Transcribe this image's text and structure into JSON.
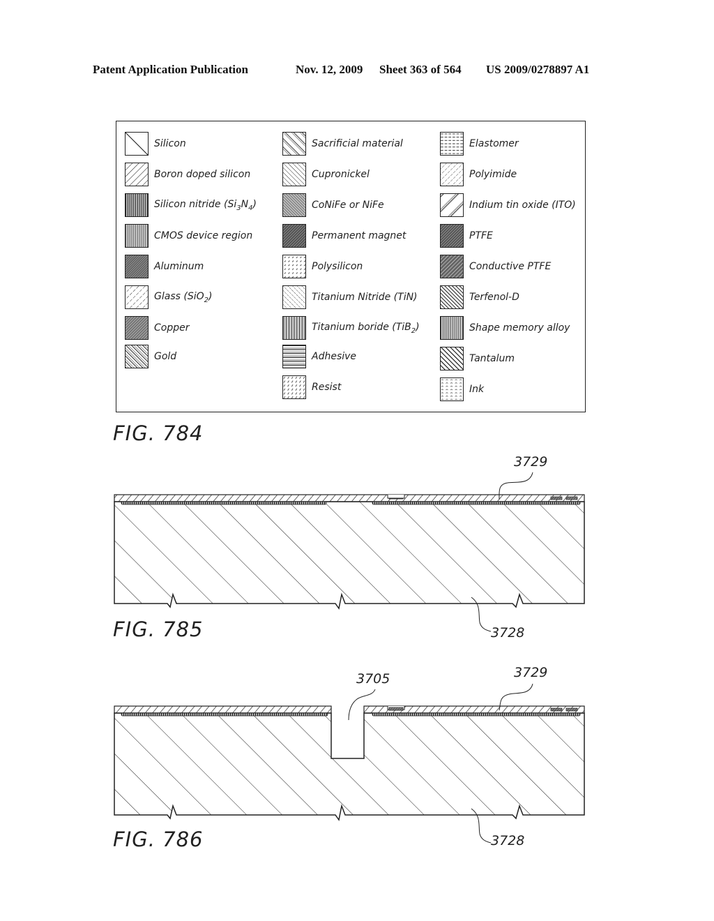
{
  "header": {
    "publication": "Patent Application Publication",
    "date": "Nov. 12, 2009",
    "sheet": "Sheet 363 of 564",
    "number": "US 2009/0278897 A1"
  },
  "legend": {
    "columns": [
      [
        {
          "label": "Silicon",
          "pattern": "silicon"
        },
        {
          "label": "Boron doped silicon",
          "pattern": "boron"
        },
        {
          "label": "Silicon nitride (Si3N4)",
          "pattern": "nitride"
        },
        {
          "label": "CMOS device region",
          "pattern": "cmos"
        },
        {
          "label": "Aluminum",
          "pattern": "aluminum"
        },
        {
          "label": "Glass (SiO2)",
          "pattern": "glass"
        },
        {
          "label": "Copper",
          "pattern": "copper"
        },
        {
          "label": "Gold",
          "pattern": "gold"
        }
      ],
      [
        {
          "label": "Sacrificial material",
          "pattern": "sacrificial"
        },
        {
          "label": "Cupronickel",
          "pattern": "cupronickel"
        },
        {
          "label": "CoNiFe or NiFe",
          "pattern": "conife"
        },
        {
          "label": "Permanent magnet",
          "pattern": "magnet"
        },
        {
          "label": "Polysilicon",
          "pattern": "polysilicon"
        },
        {
          "label": "Titanium Nitride (TiN)",
          "pattern": "tin"
        },
        {
          "label": "Titanium boride (TiB2)",
          "pattern": "tib2"
        },
        {
          "label": "Adhesive",
          "pattern": "adhesive"
        },
        {
          "label": "Resist",
          "pattern": "resist"
        }
      ],
      [
        {
          "label": "Elastomer",
          "pattern": "elastomer"
        },
        {
          "label": "Polyimide",
          "pattern": "polyimide"
        },
        {
          "label": "Indium tin oxide (ITO)",
          "pattern": "ito"
        },
        {
          "label": "PTFE",
          "pattern": "ptfe"
        },
        {
          "label": "Conductive PTFE",
          "pattern": "cptfe"
        },
        {
          "label": "Terfenol-D",
          "pattern": "terfenol"
        },
        {
          "label": "Shape memory alloy",
          "pattern": "sma"
        },
        {
          "label": "Tantalum",
          "pattern": "tantalum"
        },
        {
          "label": "Ink",
          "pattern": "ink"
        }
      ]
    ]
  },
  "figures": [
    {
      "label": "FIG. 784"
    },
    {
      "label": "FIG. 785",
      "refs": [
        "3729",
        "3728"
      ]
    },
    {
      "label": "FIG. 786",
      "refs": [
        "3705",
        "3729",
        "3728"
      ]
    }
  ]
}
